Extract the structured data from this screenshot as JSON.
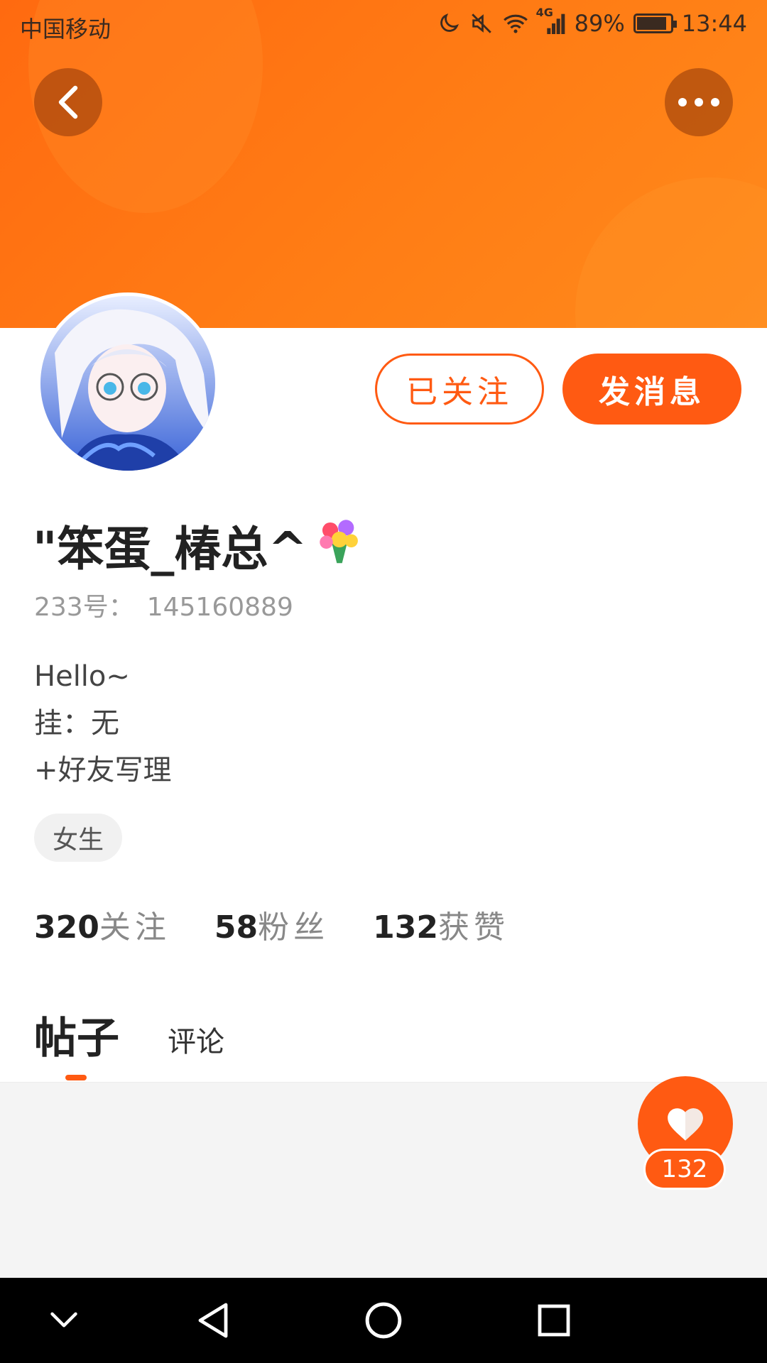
{
  "status_bar": {
    "carrier": "中国移动",
    "network": "4G",
    "battery": "89%",
    "battery_level": 0.89,
    "time": "13:44"
  },
  "header": {
    "back_icon": "chevron-left-icon",
    "more_icon": "more-dots-icon",
    "banner_color": "#ff7010"
  },
  "profile": {
    "username": "\"笨蛋_椿总^",
    "id_label": "233号：",
    "id_value": "145160889",
    "bio_lines": [
      "Hello~",
      "挂：无",
      "+好友写理"
    ],
    "gender_tag": "女生"
  },
  "actions": {
    "followed_label": "已关注",
    "message_label": "发消息"
  },
  "stats": {
    "following_count": "320",
    "following_label": "关注",
    "fans_count": "58",
    "fans_label": "粉丝",
    "likes_count": "132",
    "likes_label": "获赞"
  },
  "tabs": {
    "posts": "帖子",
    "comments": "评论",
    "active": "posts"
  },
  "like_fab": {
    "count": "132",
    "icon": "heart-icon"
  },
  "colors": {
    "accent": "#ff5a12"
  }
}
